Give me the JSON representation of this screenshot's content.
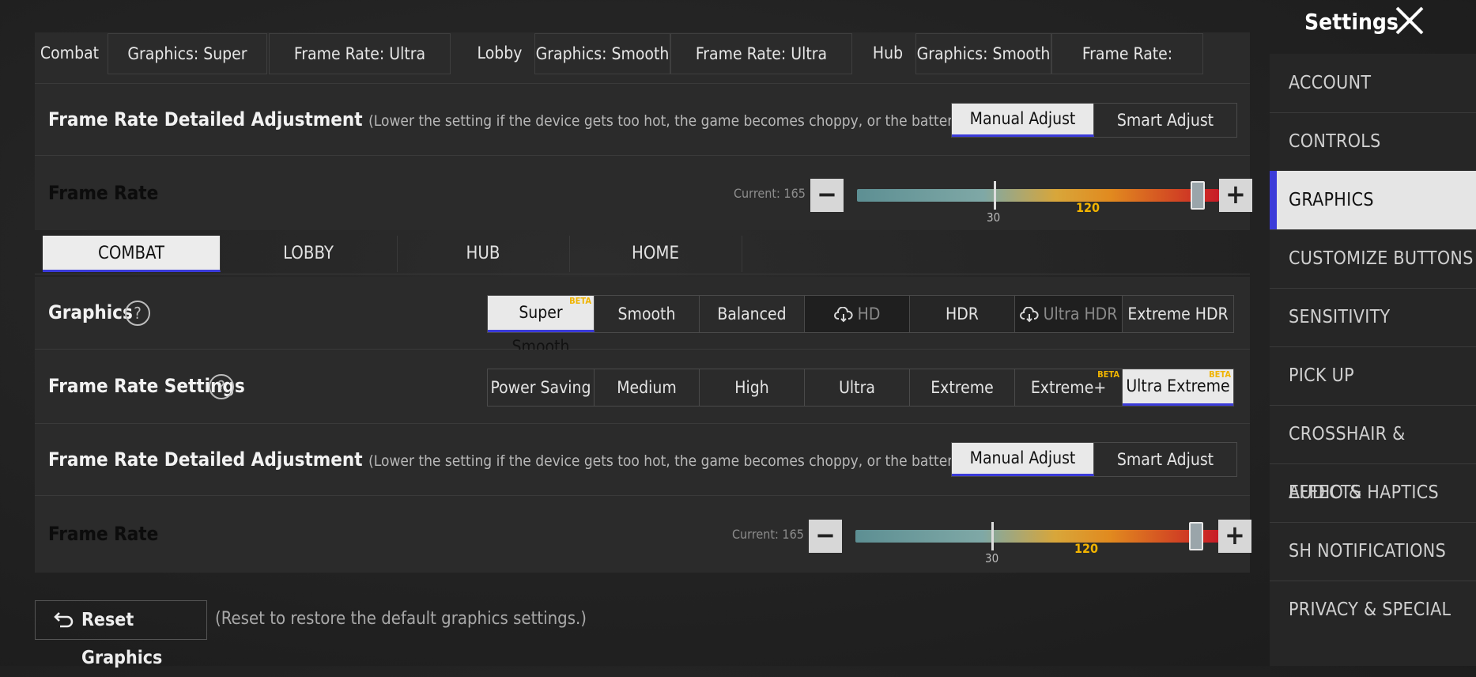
{
  "header": {
    "title": "Settings"
  },
  "summary": [
    {
      "label": "Combat"
    },
    {
      "label": "Graphics: Super Smooth"
    },
    {
      "label": "Frame Rate: Ultra Extreme"
    },
    {
      "label": "Lobby"
    },
    {
      "label": "Graphics: Smooth"
    },
    {
      "label": "Frame Rate: Ultra Extreme"
    },
    {
      "label": "Hub"
    },
    {
      "label": "Graphics: Smooth"
    },
    {
      "label": "Frame Rate: Extreme"
    }
  ],
  "adjust_top": {
    "title": "Frame Rate Detailed Adjustment",
    "hint": "(Lower the setting if the device gets too hot, the game becomes choppy, or the battery drains too quic",
    "options": [
      "Manual Adjust",
      "Smart Adjust"
    ],
    "selected": "Manual Adjust"
  },
  "framerate_top": {
    "label": "Frame Rate",
    "current_text": "Current: 165",
    "tick_low": "30",
    "tick_mid": "120",
    "level": 1.0
  },
  "tabs": [
    "COMBAT",
    "LOBBY",
    "HUB",
    "HOME"
  ],
  "active_tab": "COMBAT",
  "graphics": {
    "label": "Graphics",
    "options": [
      "Super Smooth",
      "Smooth",
      "Balanced",
      "HD",
      "HDR",
      "Ultra HDR",
      "Extreme HDR"
    ],
    "selected": "Super Smooth",
    "beta_tag": "BETA"
  },
  "framerate_settings": {
    "label": "Frame Rate Settings",
    "options": [
      "Power Saving",
      "Medium",
      "High",
      "Ultra",
      "Extreme",
      "Extreme+",
      "Ultra Extreme"
    ],
    "selected": "Ultra Extreme",
    "beta_tag": "BETA"
  },
  "adjust_bottom": {
    "title": "Frame Rate Detailed Adjustment",
    "hint": "(Lower the setting if the device gets too hot, the game becomes choppy, or the battery drains too quic",
    "options": [
      "Manual Adjust",
      "Smart Adjust"
    ],
    "selected": "Manual Adjust"
  },
  "framerate_bottom": {
    "label": "Frame Rate",
    "current_text": "Current: 165",
    "tick_low": "30",
    "tick_mid": "120",
    "level": 1.0
  },
  "reset": {
    "label": "Reset Graphics",
    "hint": "(Reset to restore the default graphics settings.)"
  },
  "sidebar": {
    "items": [
      "ACCOUNT",
      "CONTROLS",
      "GRAPHICS",
      "CUSTOMIZE BUTTONS",
      "SENSITIVITY",
      "PICK UP",
      "CROSSHAIR & EFFECTS",
      "AUDIO & HAPTICS",
      "SH NOTIFICATIONS",
      "PRIVACY & SPECIAL"
    ],
    "active": "GRAPHICS"
  },
  "colors": {
    "accent": "#3b3bd9",
    "beta": "#f0b400"
  }
}
